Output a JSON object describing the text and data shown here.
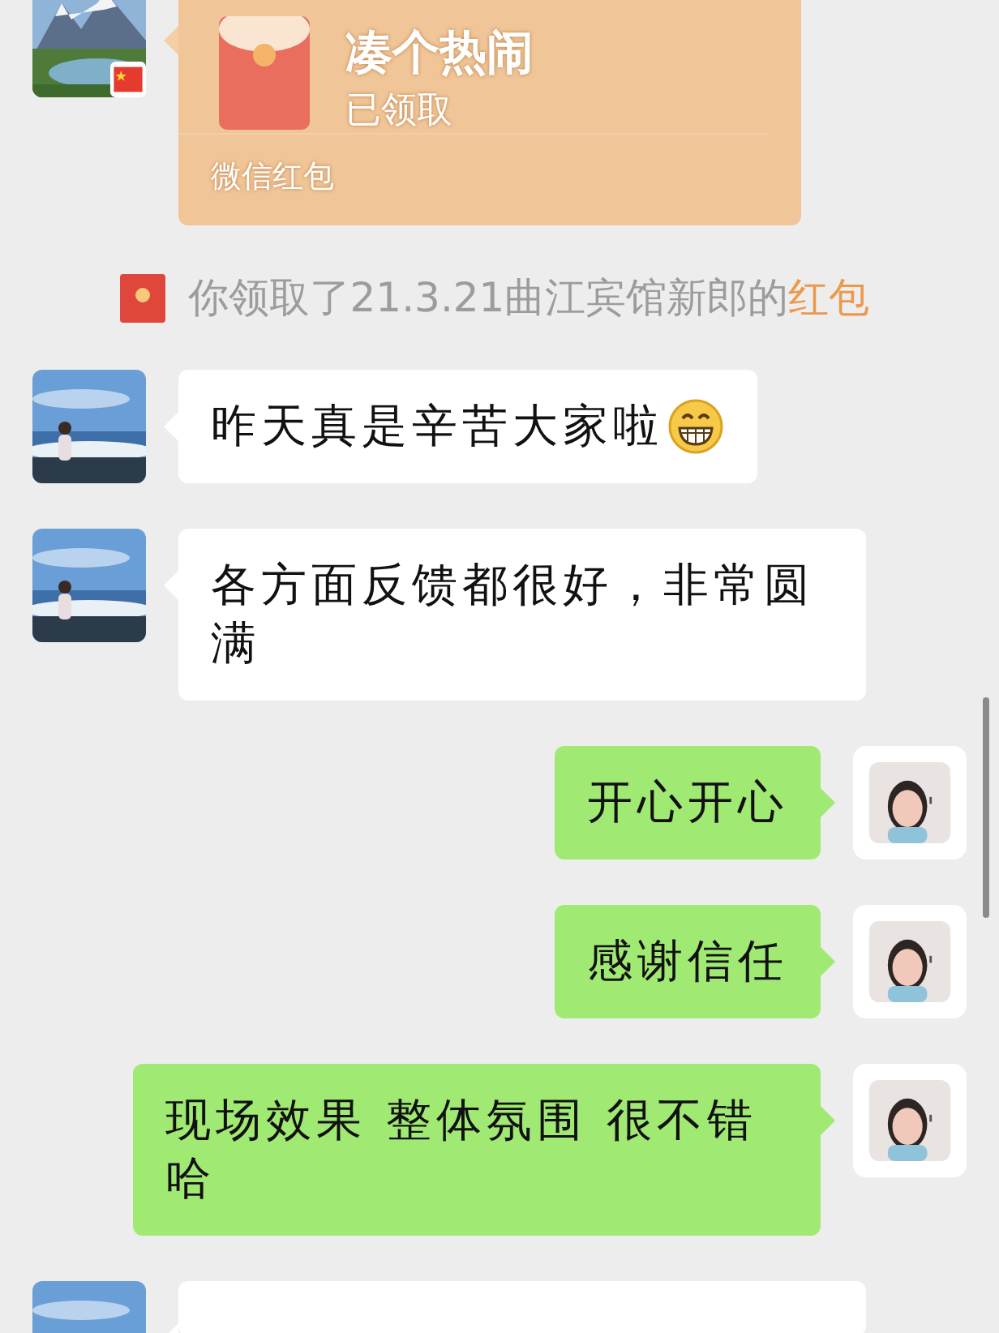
{
  "messages": [
    {
      "kind": "red_packet",
      "outgoing": false,
      "flag_badge": true,
      "title": "凑个热闹",
      "status": "已领取",
      "footer": "微信红包"
    },
    {
      "kind": "notice",
      "text": "你领取了21.3.21曲江宾馆新郎的",
      "link": "红包"
    },
    {
      "kind": "text",
      "outgoing": false,
      "text": "昨天真是辛苦大家啦",
      "grin_emoji": true
    },
    {
      "kind": "text",
      "outgoing": false,
      "text": "各方面反馈都很好，非常圆满"
    },
    {
      "kind": "text",
      "outgoing": true,
      "text": "开心开心"
    },
    {
      "kind": "text",
      "outgoing": true,
      "text": "感谢信任"
    },
    {
      "kind": "text",
      "outgoing": true,
      "text": "现场效果 整体氛围 很不错哈"
    },
    {
      "kind": "text",
      "outgoing": false,
      "text_cut_off": true
    }
  ]
}
